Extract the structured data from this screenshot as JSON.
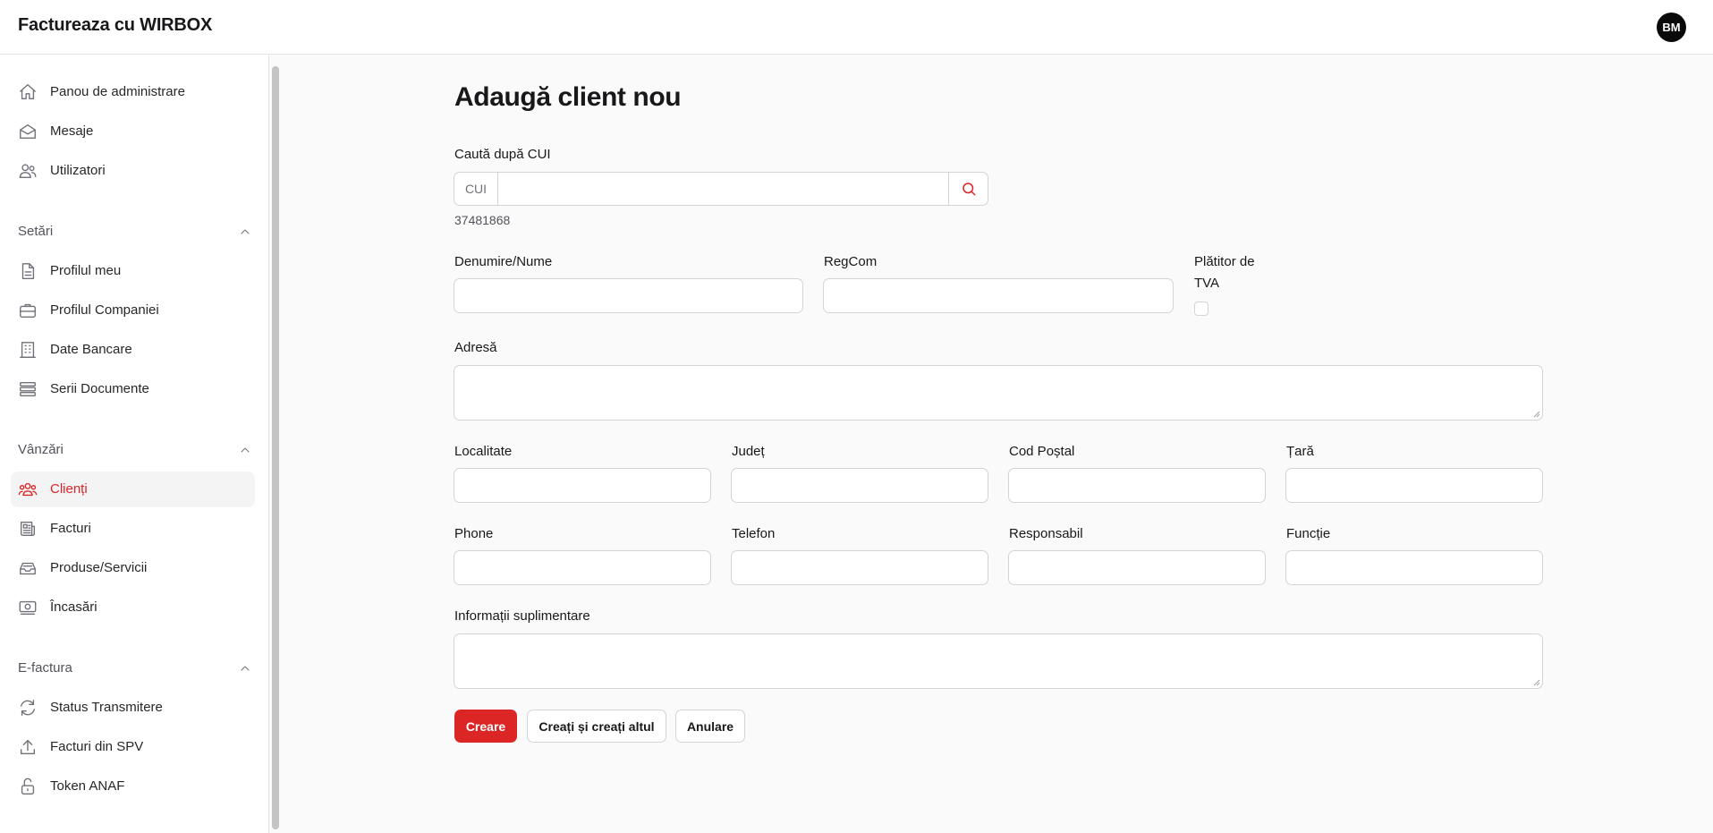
{
  "app": {
    "brand": "Factureaza cu WIRBOX",
    "user_initials": "BM"
  },
  "sidebar": {
    "main_items": [
      {
        "label": "Panou de administrare",
        "icon": "home-icon"
      },
      {
        "label": "Mesaje",
        "icon": "mail-open-icon"
      },
      {
        "label": "Utilizatori",
        "icon": "users-icon"
      }
    ],
    "sections": [
      {
        "title": "Setări",
        "items": [
          {
            "label": "Profilul meu",
            "icon": "document-icon"
          },
          {
            "label": "Profilul Companiei",
            "icon": "briefcase-icon"
          },
          {
            "label": "Date Bancare",
            "icon": "building-icon"
          },
          {
            "label": "Serii Documente",
            "icon": "stack-icon"
          }
        ]
      },
      {
        "title": "Vânzări",
        "items": [
          {
            "label": "Clienți",
            "icon": "user-group-icon",
            "active": true
          },
          {
            "label": "Facturi",
            "icon": "newspaper-icon"
          },
          {
            "label": "Produse/Servicii",
            "icon": "inbox-stack-icon"
          },
          {
            "label": "Încasări",
            "icon": "cash-icon"
          }
        ]
      },
      {
        "title": "E-factura",
        "items": [
          {
            "label": "Status Transmitere",
            "icon": "refresh-icon"
          },
          {
            "label": "Facturi din SPV",
            "icon": "upload-icon"
          },
          {
            "label": "Token ANAF",
            "icon": "unlock-icon"
          }
        ]
      }
    ]
  },
  "form": {
    "title": "Adaugă client nou",
    "cui_search": {
      "label": "Caută după CUI",
      "prefix": "CUI",
      "value": "",
      "hint": "37481868"
    },
    "fields": {
      "name": "Denumire/Nume",
      "regcom": "RegCom",
      "vat_line1": "Plătitor de",
      "vat_line2": "TVA",
      "address": "Adresă",
      "city": "Localitate",
      "county": "Județ",
      "postal": "Cod Poștal",
      "country": "Țară",
      "phone": "Phone",
      "telephone": "Telefon",
      "responsible": "Responsabil",
      "function": "Funcție",
      "extra": "Informații suplimentare"
    },
    "buttons": {
      "create": "Creare",
      "create_another": "Creați și creați altul",
      "cancel": "Anulare"
    }
  },
  "colors": {
    "accent": "#dc2626",
    "sidebar_active_bg": "#f4f4f5"
  }
}
